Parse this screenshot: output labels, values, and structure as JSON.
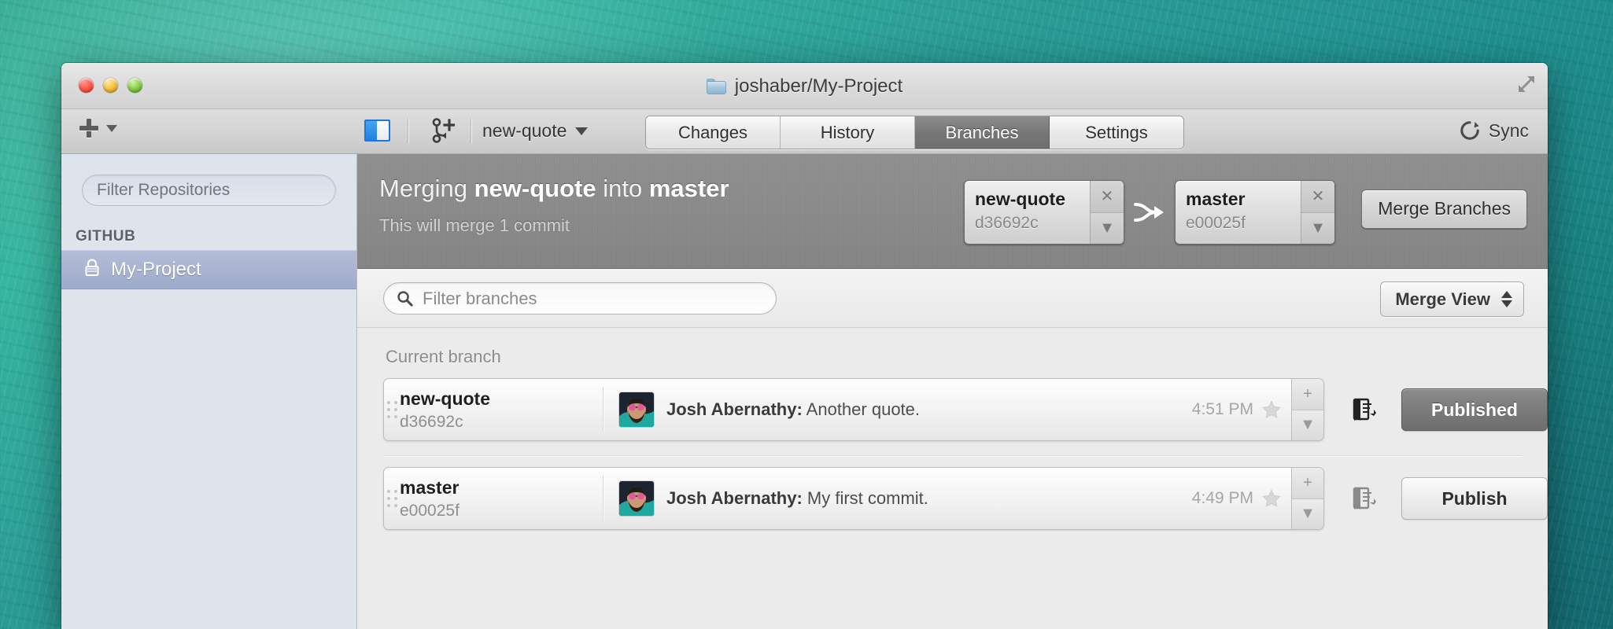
{
  "window": {
    "title": "joshaber/My-Project",
    "folder_icon": "folder-icon",
    "fullscreen_icon": "fullscreen-arrows-icon"
  },
  "toolbar": {
    "add_icon": "plus-icon",
    "add_caret_icon": "chevron-down-icon",
    "sidebar_toggle_icon": "sidebar-toggle-icon",
    "create_branch_icon": "git-branch-plus-icon",
    "current_branch": "new-quote",
    "branch_caret_icon": "chevron-down-icon",
    "tabs": [
      {
        "label": "Changes",
        "active": false
      },
      {
        "label": "History",
        "active": false
      },
      {
        "label": "Branches",
        "active": true
      },
      {
        "label": "Settings",
        "active": false
      }
    ],
    "sync_label": "Sync",
    "sync_icon": "refresh-icon"
  },
  "sidebar": {
    "filter_placeholder": "Filter Repositories",
    "section_label": "GITHUB",
    "repos": [
      {
        "name": "My-Project",
        "icon": "lock-icon",
        "selected": true
      }
    ]
  },
  "merge_header": {
    "title_prefix": "Merging ",
    "title_source": "new-quote",
    "title_middle": " into ",
    "title_target": "master",
    "subtitle": "This will merge 1 commit",
    "arrow_icon": "merge-arrow-icon",
    "tokens": [
      {
        "name": "new-quote",
        "hash": "d36692c",
        "close_icon": "close-icon",
        "caret_icon": "chevron-down-icon"
      },
      {
        "name": "master",
        "hash": "e00025f",
        "close_icon": "close-icon",
        "caret_icon": "chevron-down-icon"
      }
    ],
    "merge_button": "Merge Branches"
  },
  "filter_bar": {
    "search_icon": "search-icon",
    "search_placeholder": "Filter branches",
    "view_label": "Merge View",
    "view_caret_icon": "up-down-chevrons-icon"
  },
  "branch_list": {
    "group_label": "Current branch",
    "rows": [
      {
        "name": "new-quote",
        "hash": "d36692c",
        "author": "Josh Abernathy:",
        "message": " Another quote.",
        "time": "4:51 PM",
        "star_icon": "star-icon",
        "stepper_up_icon": "plus-icon",
        "stepper_down_icon": "chevron-down-icon",
        "pr_icon": "pull-request-icon",
        "action_label": "Published",
        "action_state": "published",
        "avatar_icon": "avatar"
      },
      {
        "name": "master",
        "hash": "e00025f",
        "author": "Josh Abernathy:",
        "message": " My first commit.",
        "time": "4:49 PM",
        "star_icon": "star-icon",
        "stepper_up_icon": "plus-icon",
        "stepper_down_icon": "chevron-down-icon",
        "pr_icon": "pull-request-icon",
        "action_label": "Publish",
        "action_state": "publish",
        "avatar_icon": "avatar"
      }
    ]
  },
  "colors": {
    "accent_blue": "#1878e0",
    "selected_repo": "#9fabcb",
    "header_gray": "#8a8a8a",
    "published_gray": "#7b7b7b"
  }
}
